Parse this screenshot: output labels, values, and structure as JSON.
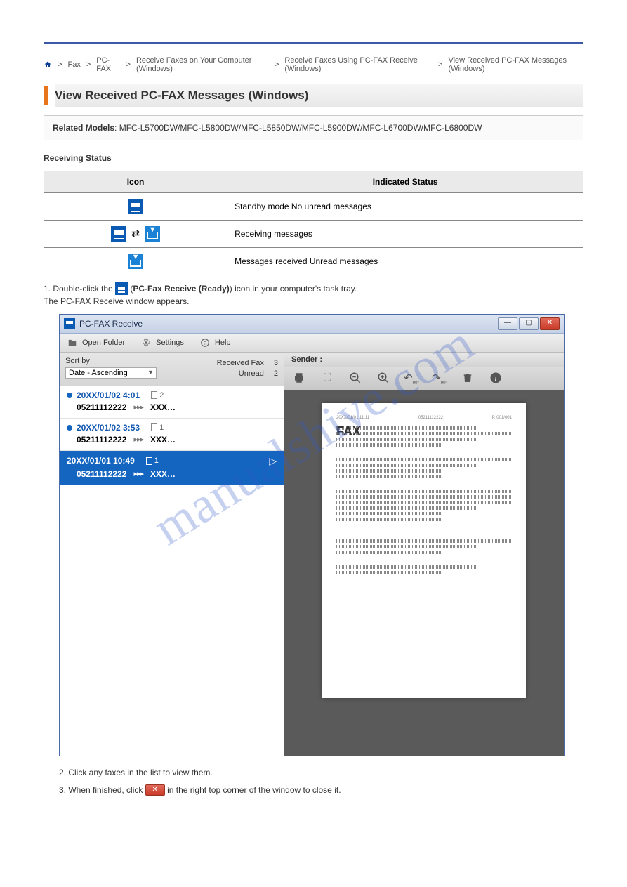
{
  "watermark": "manualshive.com",
  "breadcrumb": {
    "home": "Home",
    "sep": ">",
    "l1": "Fax",
    "l2": "PC-FAX",
    "l3": "Receive Faxes on Your Computer (Windows)",
    "l4": "Receive Faxes Using PC-FAX Receive (Windows)",
    "l5": "View Received PC-FAX Messages (Windows)"
  },
  "heading": "View Received PC-FAX Messages (Windows)",
  "models_label": "Related Models",
  "models": ": MFC-L5700DW/MFC-L5800DW/MFC-L5850DW/MFC-L5900DW/MFC-L6700DW/MFC-L6800DW",
  "status_heading": "Receiving Status",
  "table": {
    "col1": "Icon",
    "col2": "Indicated Status",
    "row1": "Standby mode No unread messages",
    "row2": "Receiving messages",
    "row3": "Messages received Unread messages"
  },
  "step1_pre": "1.    Double-click the ",
  "step1_mid": " (",
  "step1_name": "PC-Fax Receive (Ready)",
  "step1_post": ") icon in your computer's task tray.",
  "step1_result": "      The PC-FAX Receive window appears.",
  "faxwin": {
    "title": "PC-FAX Receive",
    "menu": {
      "open": "Open Folder",
      "settings": "Settings",
      "help": "Help"
    },
    "sort_label": "Sort by",
    "sort_value": "Date - Ascending",
    "recv_label": "Received Fax",
    "recv_count": "3",
    "unread_label": "Unread",
    "unread_count": "2",
    "sender_label": "Sender :",
    "items": [
      {
        "date": "20XX/01/02 4:01",
        "pages": "2",
        "phone": "05211112222",
        "dest": "XXX…",
        "unread": true
      },
      {
        "date": "20XX/01/02 3:53",
        "pages": "1",
        "phone": "05211112222",
        "dest": "XXX…",
        "unread": true
      },
      {
        "date": "20XX/01/01 10:49",
        "pages": "1",
        "phone": "05211112222",
        "dest": "XXX…",
        "selected": true
      }
    ],
    "preview": {
      "title": "FAX",
      "hdr_left": "20XX/01/01 11:11",
      "hdr_mid": "05211112222",
      "hdr_right": "P. 001/001"
    }
  },
  "step2": "2.    Click any faxes in the list to view them.",
  "step3_pre": "3.    When finished, click ",
  "step3_post": " in the right top corner of the window to close it."
}
